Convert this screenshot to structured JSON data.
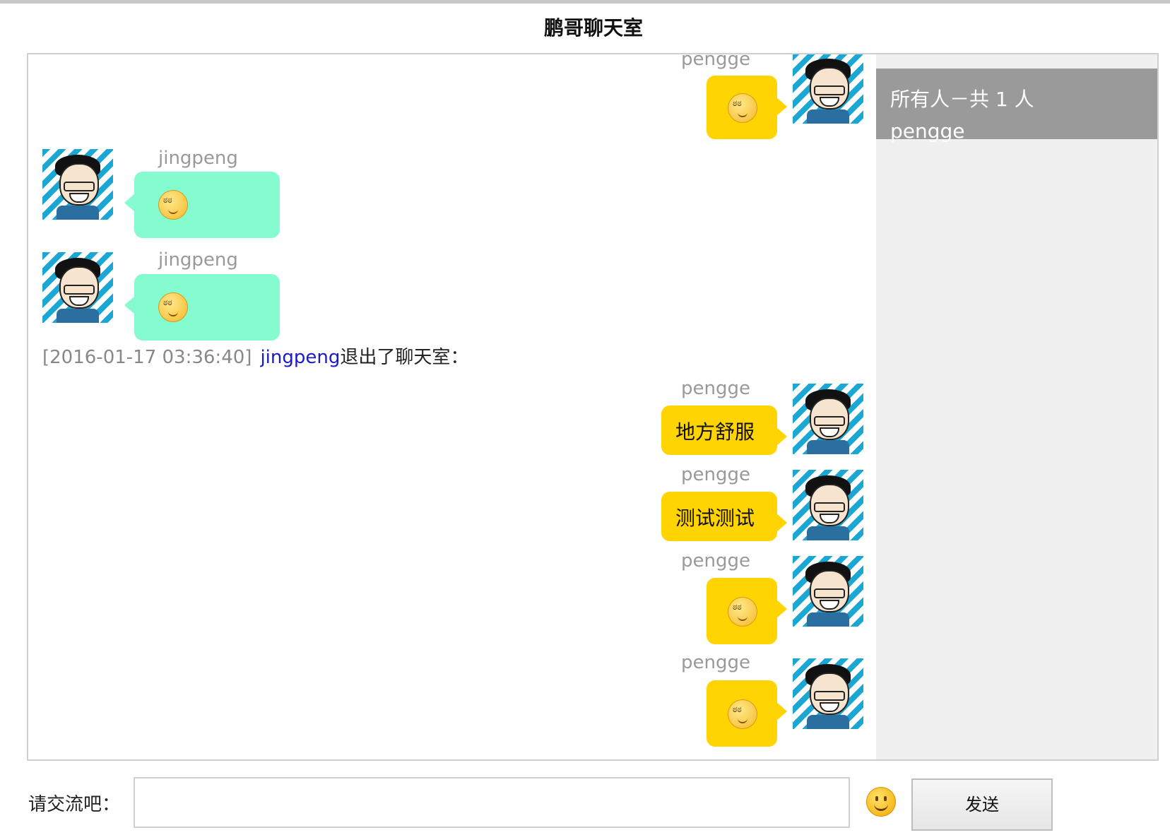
{
  "app": {
    "title": "鹏哥聊天室"
  },
  "messages": [
    {
      "sender": "pengge",
      "side": "right",
      "content_type": "emoji",
      "icon": "embarrassed-emoji-icon"
    },
    {
      "sender": "jingpeng",
      "side": "left",
      "content_type": "emoji",
      "icon": "confused-emoji-icon"
    },
    {
      "sender": "jingpeng",
      "side": "left",
      "content_type": "emoji",
      "icon": "sweating-emoji-icon"
    },
    {
      "sender": "pengge",
      "side": "right",
      "content_type": "text",
      "text": "地方舒服"
    },
    {
      "sender": "pengge",
      "side": "right",
      "content_type": "text",
      "text": "测试测试"
    },
    {
      "sender": "pengge",
      "side": "right",
      "content_type": "emoji",
      "icon": "smile-emoji-icon"
    },
    {
      "sender": "pengge",
      "side": "right",
      "content_type": "emoji",
      "icon": "confused-emoji-icon"
    }
  ],
  "system_message": {
    "timestamp": "[2016-01-17 03:36:40]",
    "user": "jingpeng",
    "action": "退出了聊天室："
  },
  "sidebar": {
    "header": "所有人－共 1 人",
    "users": [
      "pengge"
    ]
  },
  "composer": {
    "label": "请交流吧：",
    "input_value": "",
    "send_label": "发送"
  },
  "colors": {
    "self_bubble": "#ffd400",
    "other_bubble": "#84fcd0",
    "sidebar_header": "#9a9a9a",
    "sidebar_bg": "#f0f0f0",
    "link_blue": "#1a1ac8"
  }
}
